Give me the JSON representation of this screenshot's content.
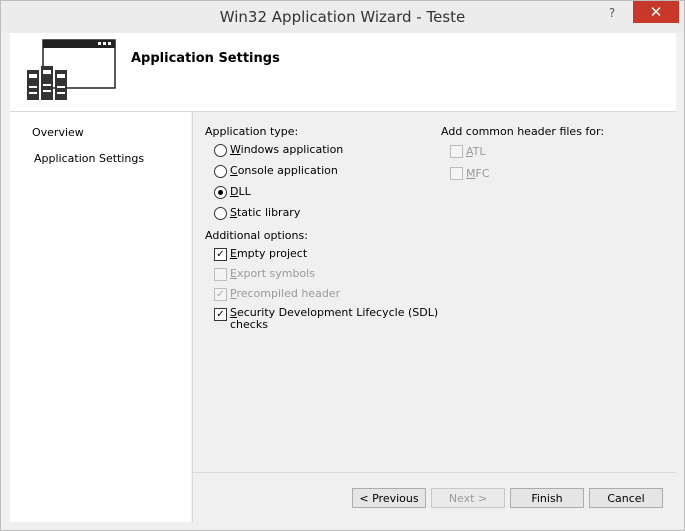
{
  "window": {
    "title": "Win32 Application Wizard - Teste",
    "help_glyph": "?",
    "close_glyph": "✕"
  },
  "header": {
    "title": "Application Settings"
  },
  "nav": {
    "items": [
      {
        "label": "Overview"
      },
      {
        "label": "Application Settings"
      }
    ]
  },
  "app_type": {
    "label": "Application type:",
    "options": [
      {
        "key": "W",
        "rest": "indows application",
        "selected": false
      },
      {
        "key": "C",
        "rest": "onsole application",
        "selected": false
      },
      {
        "key": "D",
        "rest": "LL",
        "selected": true
      },
      {
        "key": "S",
        "rest": "tatic library",
        "selected": false
      }
    ]
  },
  "additional": {
    "label": "Additional options:",
    "options": [
      {
        "key": "E",
        "rest": "mpty project",
        "checked": true,
        "enabled": true
      },
      {
        "key": "E",
        "rest": "xport symbols",
        "checked": false,
        "enabled": false
      },
      {
        "key": "P",
        "rest": "recompiled header",
        "checked": true,
        "enabled": false
      },
      {
        "key": "S",
        "rest": "ecurity Development Lifecycle (SDL)",
        "line2": "checks",
        "checked": true,
        "enabled": true
      }
    ]
  },
  "headers": {
    "label": "Add common header files for:",
    "options": [
      {
        "key": "A",
        "rest": "TL",
        "checked": false,
        "enabled": false
      },
      {
        "key": "M",
        "rest": "FC",
        "checked": false,
        "enabled": false
      }
    ]
  },
  "buttons": {
    "previous": "< Previous",
    "next": "Next >",
    "finish": "Finish",
    "cancel": "Cancel"
  },
  "check_glyph": "✓"
}
